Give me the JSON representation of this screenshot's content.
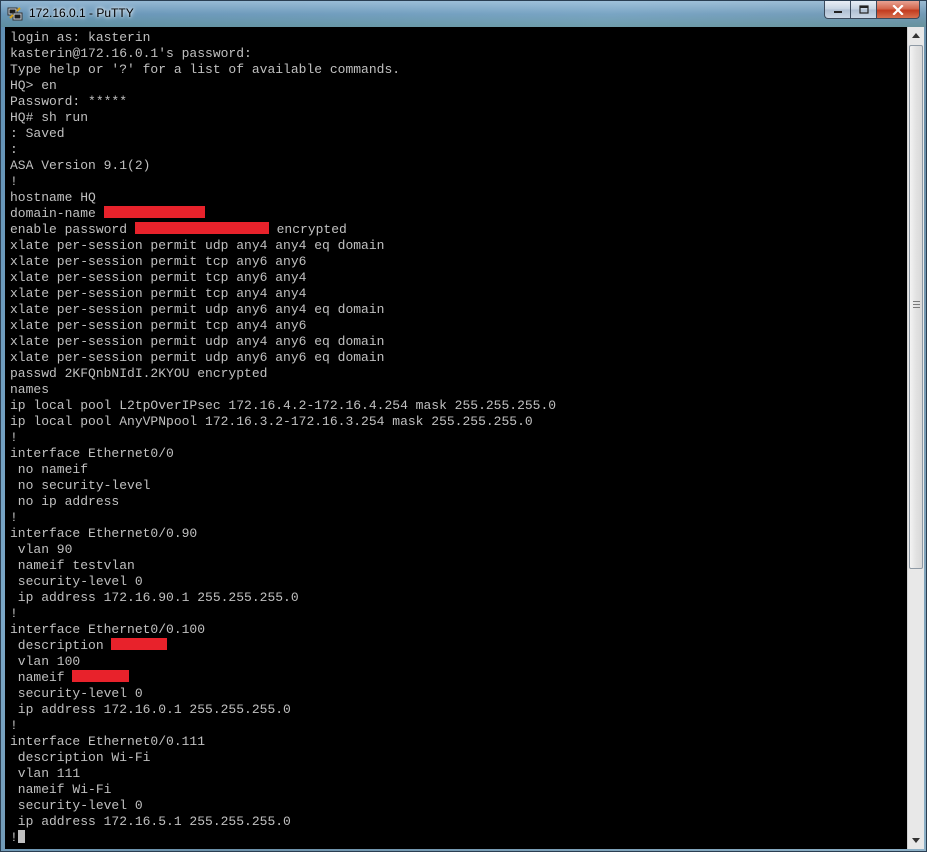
{
  "window": {
    "title": "172.16.0.1 - PuTTY"
  },
  "icons": {
    "app": "putty-icon",
    "minimize": "minimize-icon",
    "maximize": "maximize-icon",
    "close": "close-icon",
    "scroll_up": "arrow-up-icon",
    "scroll_down": "arrow-down-icon"
  },
  "colors": {
    "terminal_bg": "#000000",
    "terminal_fg": "#c0c0c0",
    "redaction": "#e8222b"
  },
  "terminal": {
    "lines": [
      {
        "text": "login as: kasterin"
      },
      {
        "text": "kasterin@172.16.0.1's password:"
      },
      {
        "text": "Type help or '?' for a list of available commands."
      },
      {
        "text": "HQ> en"
      },
      {
        "text": "Password: *****"
      },
      {
        "text": "HQ# sh run"
      },
      {
        "text": ": Saved"
      },
      {
        "text": ":"
      },
      {
        "text": "ASA Version 9.1(2)"
      },
      {
        "text": "!"
      },
      {
        "text": "hostname HQ"
      },
      {
        "text": "domain-name ",
        "redacted": true
      },
      {
        "text": "enable password ",
        "redacted": true,
        "after": " encrypted"
      },
      {
        "text": "xlate per-session permit udp any4 any4 eq domain"
      },
      {
        "text": "xlate per-session permit tcp any6 any6"
      },
      {
        "text": "xlate per-session permit tcp any6 any4"
      },
      {
        "text": "xlate per-session permit tcp any4 any4"
      },
      {
        "text": "xlate per-session permit udp any6 any4 eq domain"
      },
      {
        "text": "xlate per-session permit tcp any4 any6"
      },
      {
        "text": "xlate per-session permit udp any4 any6 eq domain"
      },
      {
        "text": "xlate per-session permit udp any6 any6 eq domain"
      },
      {
        "text": "passwd 2KFQnbNIdI.2KYOU encrypted"
      },
      {
        "text": "names"
      },
      {
        "text": "ip local pool L2tpOverIPsec 172.16.4.2-172.16.4.254 mask 255.255.255.0"
      },
      {
        "text": "ip local pool AnyVPNpool 172.16.3.2-172.16.3.254 mask 255.255.255.0"
      },
      {
        "text": "!"
      },
      {
        "text": "interface Ethernet0/0"
      },
      {
        "text": " no nameif"
      },
      {
        "text": " no security-level"
      },
      {
        "text": " no ip address"
      },
      {
        "text": "!"
      },
      {
        "text": "interface Ethernet0/0.90"
      },
      {
        "text": " vlan 90"
      },
      {
        "text": " nameif testvlan"
      },
      {
        "text": " security-level 0"
      },
      {
        "text": " ip address 172.16.90.1 255.255.255.0"
      },
      {
        "text": "!"
      },
      {
        "text": "interface Ethernet0/0.100"
      },
      {
        "text": " description ",
        "redacted": true
      },
      {
        "text": " vlan 100"
      },
      {
        "text": " nameif ",
        "redacted": true
      },
      {
        "text": " security-level 0"
      },
      {
        "text": " ip address 172.16.0.1 255.255.255.0"
      },
      {
        "text": "!"
      },
      {
        "text": "interface Ethernet0/0.111"
      },
      {
        "text": " description Wi-Fi"
      },
      {
        "text": " vlan 111"
      },
      {
        "text": " nameif Wi-Fi"
      },
      {
        "text": " security-level 0"
      },
      {
        "text": " ip address 172.16.5.1 255.255.255.0"
      },
      {
        "text": "!",
        "cursor": true
      }
    ]
  }
}
